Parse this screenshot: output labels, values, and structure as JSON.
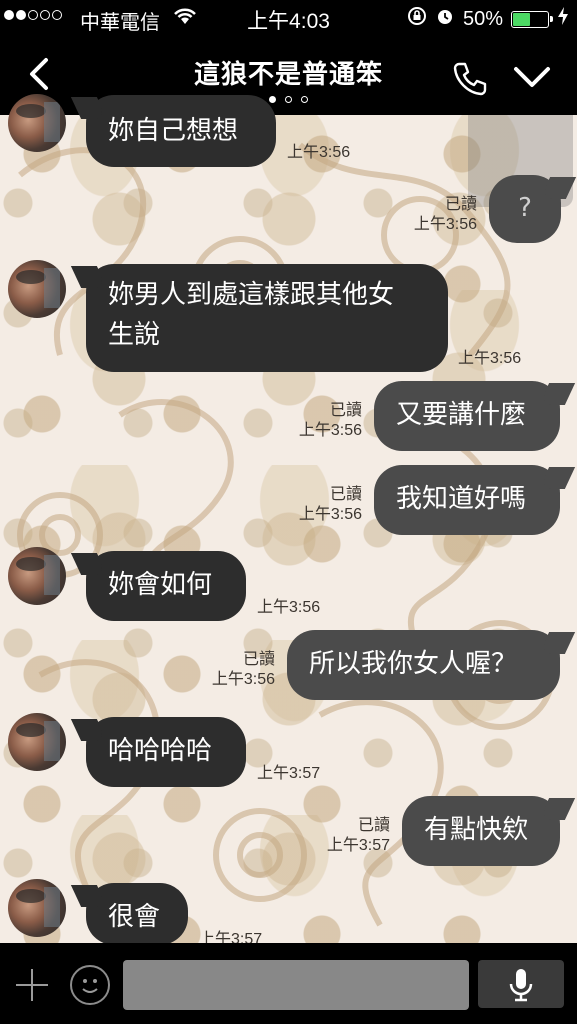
{
  "status_bar": {
    "carrier": "中華電信",
    "time": "上午4:03",
    "battery_percent": "50%",
    "battery_level": 0.5,
    "signal_bars_filled": 2,
    "signal_bars_total": 5
  },
  "header": {
    "title": "這狼不是普通笨",
    "page_count": 3,
    "active_page": 1
  },
  "messages": [
    {
      "side": "in",
      "text": "妳自己想想",
      "time": "上午3:56"
    },
    {
      "side": "out",
      "text": "?",
      "read": "已讀",
      "time": "上午3:56"
    },
    {
      "side": "in",
      "text_lines": [
        "妳男人到處這樣跟其他女",
        "生說"
      ],
      "time": "上午3:56"
    },
    {
      "side": "out",
      "text": "又要講什麼",
      "read": "已讀",
      "time": "上午3:56"
    },
    {
      "side": "out",
      "text": "我知道好嗎",
      "read": "已讀",
      "time": "上午3:56"
    },
    {
      "side": "in",
      "text": "妳會如何",
      "time": "上午3:56"
    },
    {
      "side": "out",
      "text": "所以我你女人喔？",
      "read": "已讀",
      "time": "上午3:56"
    },
    {
      "side": "in",
      "text": "哈哈哈哈",
      "time": "上午3:57"
    },
    {
      "side": "out",
      "text": "有點快欸",
      "read": "已讀",
      "time": "上午3:57"
    },
    {
      "side": "in",
      "text": "很會",
      "time": "上午3:57"
    }
  ],
  "colors": {
    "bar_bg": "#000000",
    "incoming_bubble": "#2d2d2d",
    "outgoing_bubble": "#4b4b4b",
    "battery_fill": "#4cd964",
    "wallpaper_base": "#f4ece4"
  },
  "icons": {
    "back": "chevron-left-icon",
    "call": "phone-icon",
    "menu": "chevron-down-icon",
    "plus": "plus-icon",
    "emoji": "smiley-icon",
    "mic": "microphone-icon"
  }
}
